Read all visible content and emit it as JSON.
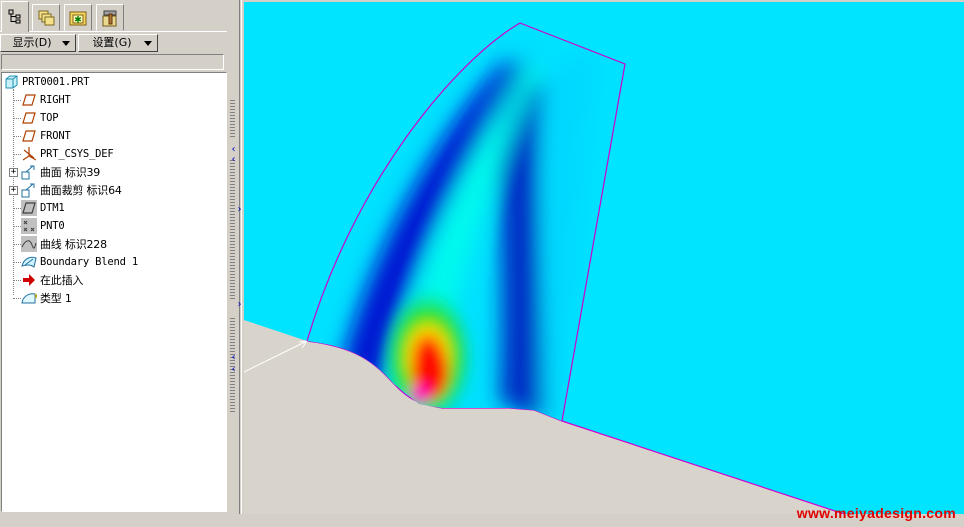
{
  "toolbar": {
    "tabs": [
      {
        "name": "model-tree-tab",
        "icon": "model-tree-icon",
        "active": true
      },
      {
        "name": "layers-tab",
        "icon": "layers-icon"
      },
      {
        "name": "favorites-tab",
        "icon": "folder-star-icon"
      },
      {
        "name": "tools-tab",
        "icon": "hammer-icon"
      }
    ],
    "show_label": "显示(D)",
    "settings_label": "设置(G)"
  },
  "tree": {
    "root": "PRT0001.PRT",
    "items": [
      {
        "label": "RIGHT",
        "icon": "datum-plane-icon"
      },
      {
        "label": "TOP",
        "icon": "datum-plane-icon"
      },
      {
        "label": "FRONT",
        "icon": "datum-plane-icon"
      },
      {
        "label": "PRT_CSYS_DEF",
        "icon": "coordinate-system-icon"
      },
      {
        "label": "曲面 标识39",
        "icon": "surface-icon",
        "expandable": true
      },
      {
        "label": "曲面裁剪 标识64",
        "icon": "surface-trim-icon",
        "expandable": true
      },
      {
        "label": "DTM1",
        "icon": "datum-plane-icon"
      },
      {
        "label": "PNT0",
        "icon": "datum-point-icon"
      },
      {
        "label": "曲线 标识228",
        "icon": "curve-icon"
      },
      {
        "label": "Boundary Blend 1",
        "icon": "boundary-blend-icon"
      },
      {
        "label": "在此插入",
        "icon": "insert-here-arrow-icon"
      },
      {
        "label": "类型 1",
        "icon": "surface-analysis-icon"
      }
    ]
  },
  "colors": {
    "background": "#00e4ff",
    "surface_edge": "#d000d0",
    "base_surface": "#d8d4cc"
  },
  "watermark": "www.meiyadesign.com"
}
